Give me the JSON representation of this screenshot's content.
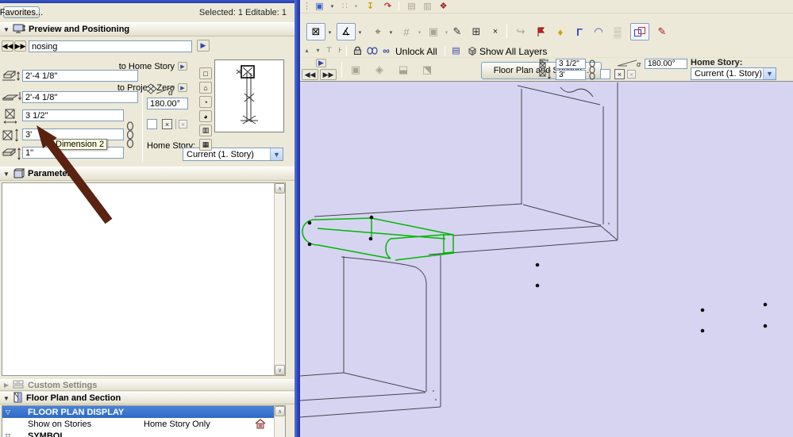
{
  "dialog": {
    "favorites_button": "Favorites...",
    "status": "Selected: 1 Editable: 1",
    "preview_positioning": {
      "title": "Preview and Positioning",
      "name_value": "nosing",
      "to_home_story": "to Home Story",
      "home_story_offset": "2'-4 1/8\"",
      "to_project_zero": "to Project Zero",
      "project_zero_offset": "2'-4 1/8\"",
      "dimension_1": "3 1/2\"",
      "dimension_2": "3'",
      "dimension_3": "1\"",
      "rotation_angle": "180.00°",
      "home_story_label": "Home Story:",
      "home_story_value": "Current (1. Story)",
      "dimension2_tooltip": "Dimension 2"
    },
    "parameters_title": "Parameters",
    "custom_settings_title": "Custom Settings",
    "floor_plan_section": {
      "title": "Floor Plan and Section",
      "group_1": "FLOOR PLAN DISPLAY",
      "row_label": "Show on Stories",
      "row_value": "Home Story Only",
      "group_2": "SYMBOL"
    }
  },
  "toolbar": {
    "unlock_all": "Unlock All",
    "show_all_layers": "Show All Layers"
  },
  "infobar": {
    "floor_plan_button": "Floor Plan and Section...",
    "dimension_1": "3 1/2\"",
    "dimension_2": "3'",
    "rotation_angle": "180.00°",
    "home_story_label": "Home Story:",
    "home_story_value": "Current (1. Story)"
  },
  "colors": {
    "selection_green": "#00b800",
    "canvas_background": "#d7d4f2",
    "highlight_blue": "#316ac5",
    "annotation_arrow": "#5a2210",
    "window_border_blue": "#3a56c8",
    "panel_background": "#ece9d8"
  }
}
